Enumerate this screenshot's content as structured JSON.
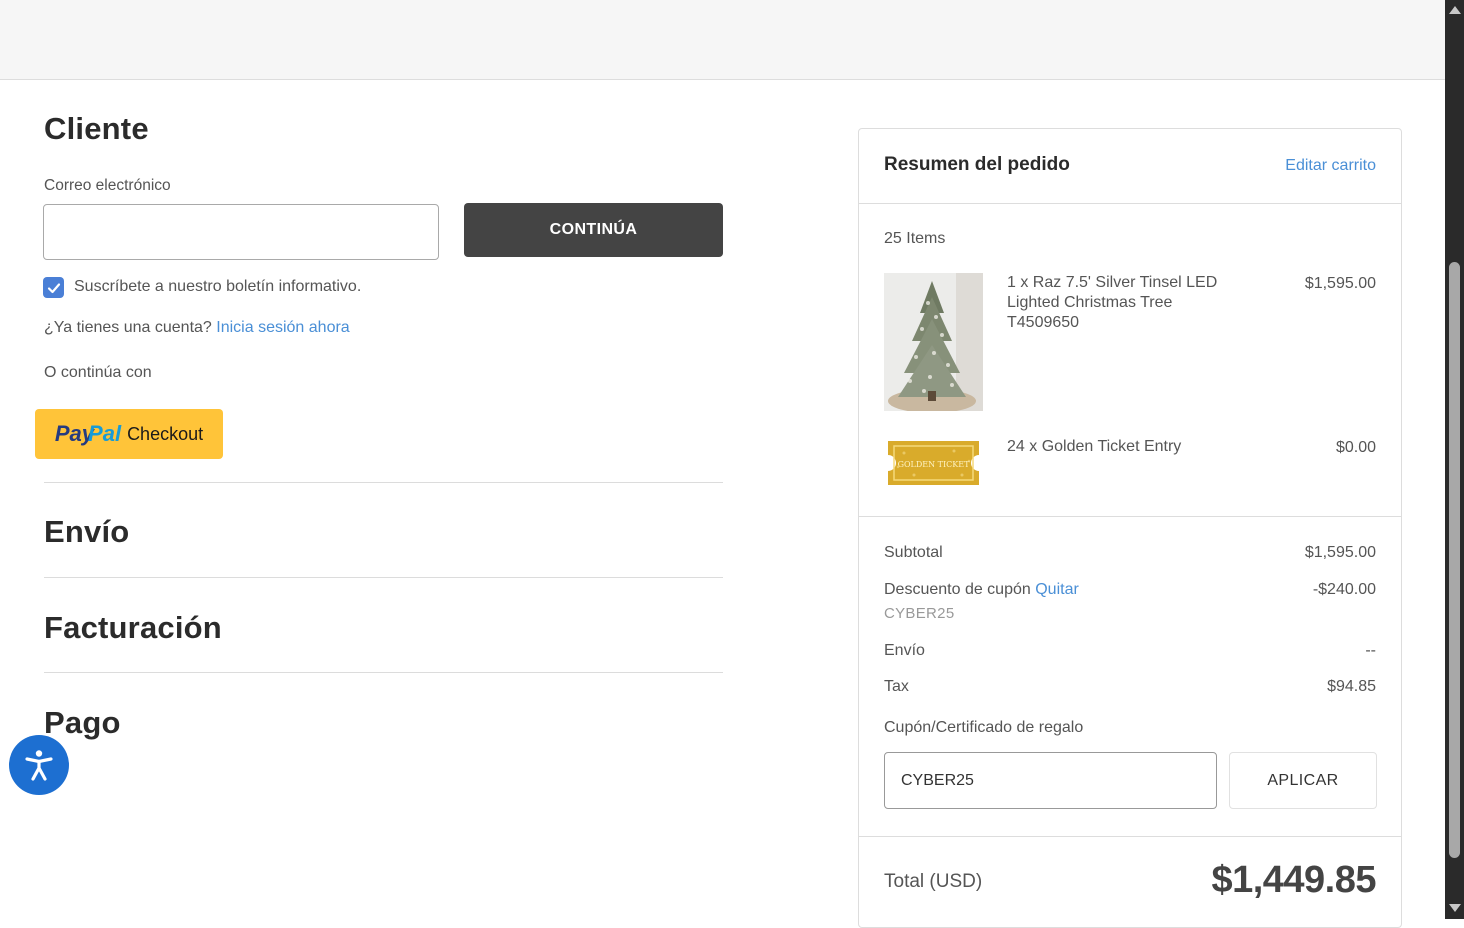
{
  "customer": {
    "title": "Cliente",
    "email_label": "Correo electrónico",
    "email_value": "",
    "continue_label": "CONTINÚA",
    "subscribe_label": "Suscríbete a nuestro boletín informativo.",
    "subscribe_checked": true,
    "account_prompt": "¿Ya tienes una cuenta?",
    "signin_link": "Inicia sesión ahora",
    "or_continue": "O continúa con",
    "paypal": {
      "pay": "Pay",
      "pal": "Pal",
      "checkout": "Checkout"
    }
  },
  "sections": {
    "shipping": "Envío",
    "billing": "Facturación",
    "payment": "Pago"
  },
  "summary": {
    "title": "Resumen del pedido",
    "edit_cart": "Editar carrito",
    "items_count": "25 Items",
    "products": [
      {
        "name": "1 x Raz 7.5' Silver Tinsel LED Lighted Christmas Tree T4509650",
        "price": "$1,595.00",
        "image": "christmas-tree-image"
      },
      {
        "name": "24 x Golden Ticket Entry",
        "price": "$0.00",
        "image": "golden-ticket-image",
        "image_text": "GOLDEN TICKET"
      }
    ],
    "subtotal_label": "Subtotal",
    "subtotal_value": "$1,595.00",
    "discount_label": "Descuento de cupón",
    "remove_link": "Quitar",
    "discount_value": "-$240.00",
    "coupon_code": "CYBER25",
    "shipping_label": "Envío",
    "shipping_value": "--",
    "tax_label": "Tax",
    "tax_value": "$94.85",
    "coupon_field_label": "Cupón/Certificado de regalo",
    "coupon_input_value": "CYBER25",
    "apply_label": "APLICAR",
    "total_label": "Total (USD)",
    "total_value": "$1,449.85"
  },
  "colors": {
    "accent_link": "#4a8fd6",
    "button_dark": "#444444",
    "paypal_yellow": "#ffc439",
    "accessibility_blue": "#1d6fd1"
  }
}
